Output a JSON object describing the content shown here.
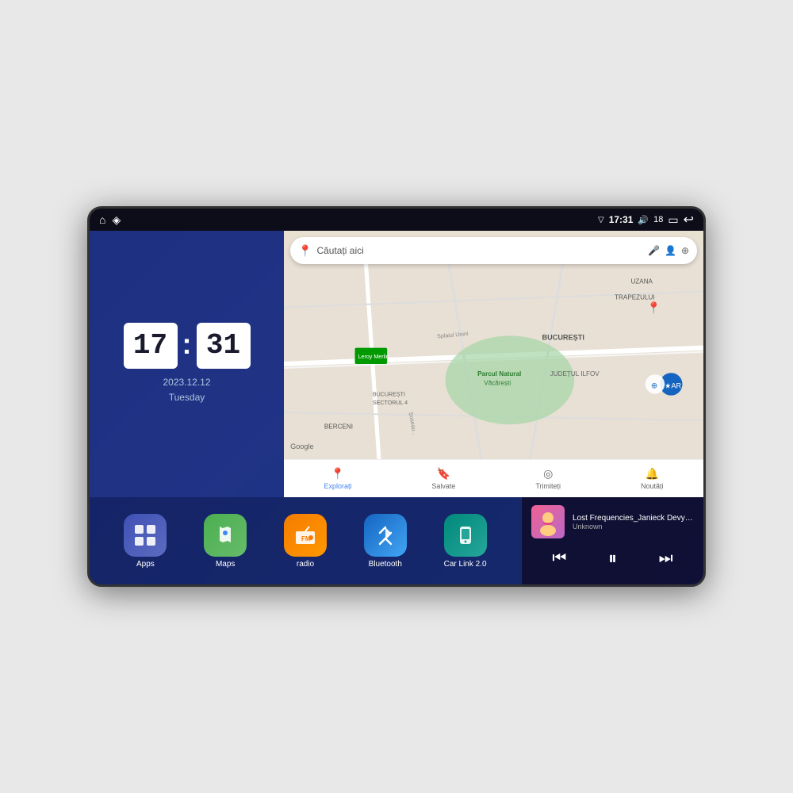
{
  "device": {
    "status_bar": {
      "time": "17:31",
      "battery": "18",
      "signal_icon": "▽",
      "volume_icon": "🔊",
      "battery_box": "▭",
      "back_icon": "↩"
    },
    "clock": {
      "hours": "17",
      "minutes": "31",
      "date": "2023.12.12",
      "day": "Tuesday"
    },
    "map": {
      "search_placeholder": "Căutați aici",
      "nav_items": [
        {
          "label": "Explorați",
          "icon": "📍",
          "active": true
        },
        {
          "label": "Salvate",
          "icon": "🔖",
          "active": false
        },
        {
          "label": "Trimiteți",
          "icon": "◎",
          "active": false
        },
        {
          "label": "Noutăți",
          "icon": "🔔",
          "active": false
        }
      ],
      "place_labels": [
        "BERCENI",
        "BUCUREȘTI",
        "JUDEȚUL ILFOV",
        "TRAPEZULUI",
        "UZANA",
        "Parcul Natural Văcărești",
        "Leroy Merlin",
        "BUCUREȘTI SECTORUL 4"
      ]
    },
    "apps": [
      {
        "id": "apps",
        "label": "Apps",
        "color_class": "apps-bg",
        "icon": "⊞"
      },
      {
        "id": "maps",
        "label": "Maps",
        "color_class": "maps-bg",
        "icon": "🗺"
      },
      {
        "id": "radio",
        "label": "radio",
        "color_class": "radio-bg",
        "icon": "📻"
      },
      {
        "id": "bluetooth",
        "label": "Bluetooth",
        "color_class": "bt-bg",
        "icon": "ᛒ"
      },
      {
        "id": "carlink",
        "label": "Car Link 2.0",
        "color_class": "carlink-bg",
        "icon": "📱"
      }
    ],
    "music": {
      "title": "Lost Frequencies_Janieck Devy-...",
      "artist": "Unknown",
      "thumb_emoji": "👩"
    }
  }
}
